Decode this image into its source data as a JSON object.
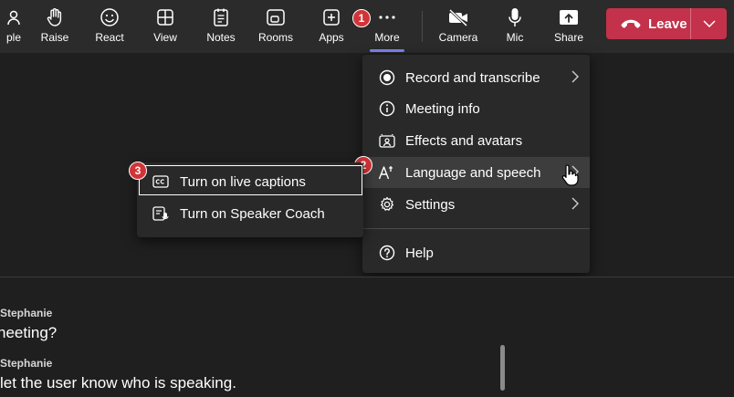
{
  "toolbar": {
    "items": [
      {
        "label": "ple"
      },
      {
        "label": "Raise"
      },
      {
        "label": "React"
      },
      {
        "label": "View"
      },
      {
        "label": "Notes"
      },
      {
        "label": "Rooms"
      },
      {
        "label": "Apps"
      },
      {
        "label": "More"
      },
      {
        "label": "Camera"
      },
      {
        "label": "Mic"
      },
      {
        "label": "Share"
      }
    ],
    "leave_label": "Leave"
  },
  "badges": [
    "1",
    "2",
    "3"
  ],
  "more_menu": {
    "items": [
      {
        "label": "Record and transcribe"
      },
      {
        "label": "Meeting info"
      },
      {
        "label": "Effects and avatars"
      },
      {
        "label": "Language and speech"
      },
      {
        "label": "Settings"
      },
      {
        "label": "Help"
      }
    ]
  },
  "language_submenu": {
    "items": [
      {
        "label": "Turn on live captions"
      },
      {
        "label": "Turn on Speaker Coach"
      }
    ]
  },
  "captions": [
    {
      "speaker": "Stephanie",
      "text": "neeting?"
    },
    {
      "speaker": "Stephanie",
      "text": "let the user know who is speaking."
    }
  ],
  "colors": {
    "leave": "#c4314b",
    "accent": "#7f85f5",
    "badge": "#d13438"
  }
}
